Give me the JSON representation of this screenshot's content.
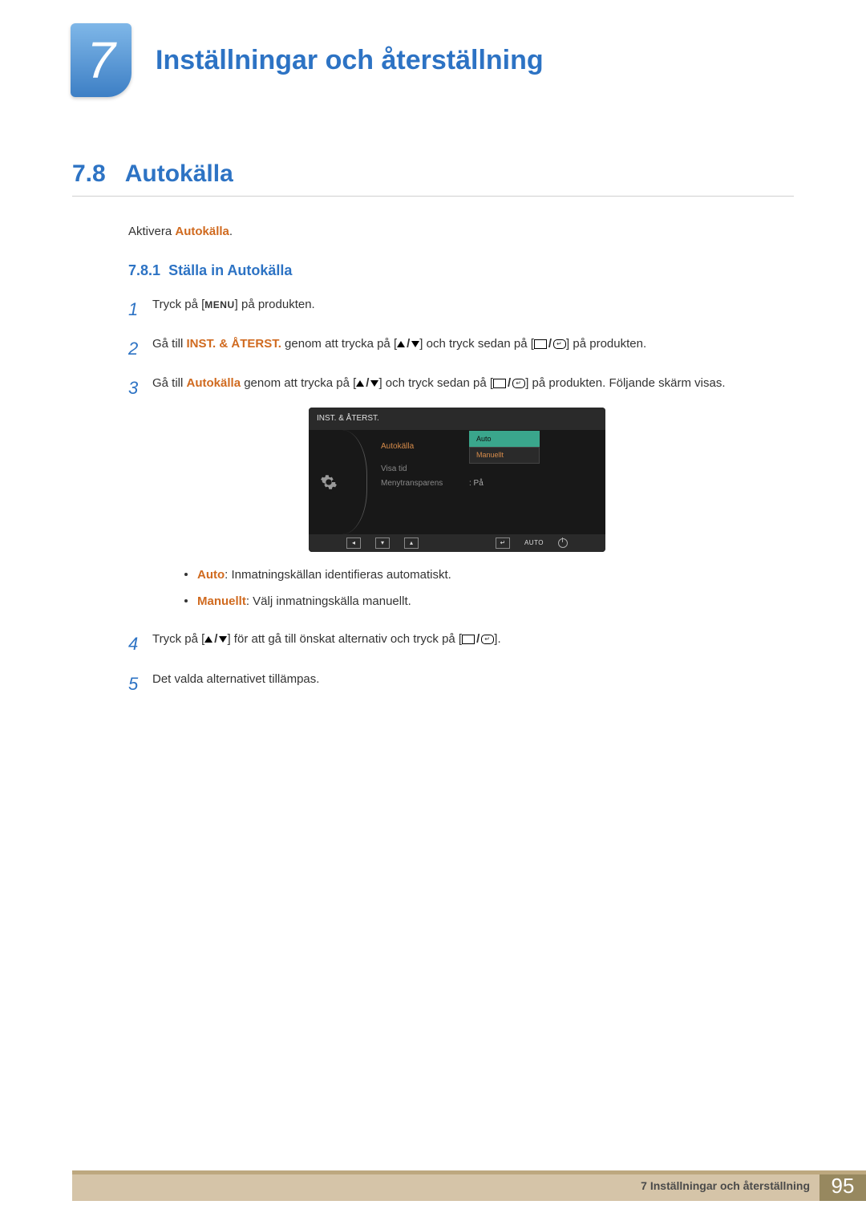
{
  "header": {
    "chapter_number": "7",
    "chapter_title": "Inställningar och återställning"
  },
  "section": {
    "number": "7.8",
    "title": "Autokälla"
  },
  "intro": {
    "prefix": "Aktivera ",
    "highlight": "Autokälla",
    "suffix": "."
  },
  "subsection": {
    "number": "7.8.1",
    "title": "Ställa in Autokälla"
  },
  "steps": {
    "s1": {
      "num": "1",
      "a": "Tryck på [",
      "menu": "MENU",
      "b": "] på produkten."
    },
    "s2": {
      "num": "2",
      "a": "Gå till ",
      "hl": "INST. & ÅTERST.",
      "b": " genom att trycka på [",
      "c": "] och tryck sedan på [",
      "d": "] på produkten."
    },
    "s3": {
      "num": "3",
      "a": "Gå till ",
      "hl": "Autokälla",
      "b": " genom att trycka på [",
      "c": "] och tryck sedan på [",
      "d": "] på produkten. Följande skärm visas."
    },
    "s4": {
      "num": "4",
      "a": "Tryck på [",
      "b": "] för att gå till önskat alternativ och tryck på [",
      "c": "]."
    },
    "s5": {
      "num": "5",
      "text": "Det valda alternativet tillämpas."
    }
  },
  "osd": {
    "title": "INST. & ÅTERST.",
    "items": {
      "autokalla": "Autokälla",
      "visatid": "Visa tid",
      "menytrans": "Menytransparens"
    },
    "values": {
      "auto": "Auto",
      "manuellt": "Manuellt",
      "pa": ": På"
    },
    "bottom_auto": "AUTO"
  },
  "bullets": {
    "b1": {
      "hl": "Auto",
      "rest": ": Inmatningskällan identifieras automatiskt."
    },
    "b2": {
      "hl": "Manuellt",
      "rest": ": Välj inmatningskälla manuellt."
    }
  },
  "footer": {
    "text": "7 Inställningar och återställning",
    "page": "95"
  }
}
